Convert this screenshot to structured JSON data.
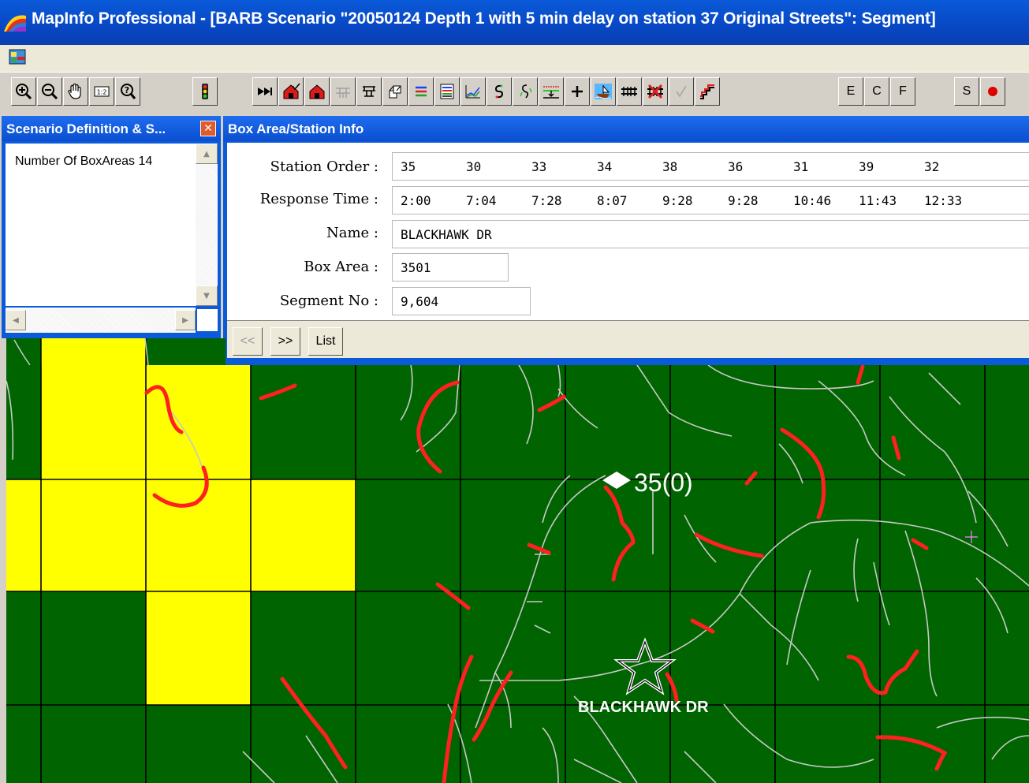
{
  "window": {
    "title": "MapInfo Professional - [BARB Scenario \"20050124 Depth 1 with 5 min delay on station 37 Original Streets\": Segment]"
  },
  "toolbar": {
    "buttons": [
      {
        "name": "zoom-in-icon"
      },
      {
        "name": "zoom-out-icon"
      },
      {
        "name": "grabber-hand-icon"
      },
      {
        "name": "change-view-icon"
      },
      {
        "name": "info-tool-icon"
      },
      {
        "name": "traffic-light-icon"
      },
      {
        "name": "fast-forward-icon"
      },
      {
        "name": "station-check-icon"
      },
      {
        "name": "station-icon"
      },
      {
        "name": "grid-disabled-icon"
      },
      {
        "name": "route-tool-icon"
      },
      {
        "name": "stack-tool-icon"
      },
      {
        "name": "lines-icon"
      },
      {
        "name": "table-icon"
      },
      {
        "name": "graph-icon"
      },
      {
        "name": "segment-s-icon"
      },
      {
        "name": "segment-split-icon"
      },
      {
        "name": "ruler-icon"
      },
      {
        "name": "plus-icon"
      },
      {
        "name": "boat-icon"
      },
      {
        "name": "rail-icon"
      },
      {
        "name": "rail-cross-icon"
      },
      {
        "name": "check-disabled-icon"
      },
      {
        "name": "stairs-icon"
      }
    ],
    "text_buttons": [
      "E",
      "C",
      "F",
      "S"
    ]
  },
  "scenario_panel": {
    "title": "Scenario Definition & S...",
    "content": "Number Of BoxAreas 14"
  },
  "info_panel": {
    "title": "Box Area/Station Info",
    "station_order_label": "Station Order :",
    "station_order": [
      "35",
      "30",
      "33",
      "34",
      "38",
      "36",
      "31",
      "39",
      "32"
    ],
    "response_time_label": "Response Time :",
    "response_time": [
      "2:00",
      "7:04",
      "7:28",
      "8:07",
      "9:28",
      "9:28",
      "10:46",
      "11:43",
      "12:33"
    ],
    "name_label": "Name :",
    "name_value": "BLACKHAWK DR",
    "box_area_label": "Box Area :",
    "box_area_value": "3501",
    "segment_no_label": "Segment No :",
    "segment_no_value": "9,604",
    "prev_label": "<<",
    "next_label": ">>",
    "list_label": "List"
  },
  "map": {
    "station_label": "35(0)",
    "street_label": "BLACKHAWK DR",
    "colors": {
      "green": "#006400",
      "yellow": "#ffff00",
      "red": "#ff2020",
      "street": "#c8c8c8",
      "grid": "#000000"
    }
  }
}
